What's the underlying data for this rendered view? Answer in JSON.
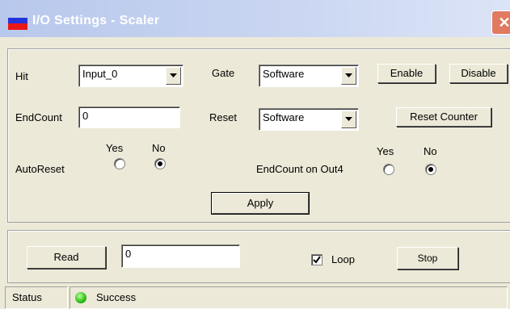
{
  "window": {
    "title": "I/O Settings - Scaler",
    "close_glyph": "✕"
  },
  "hit": {
    "label": "Hit",
    "value": "Input_0"
  },
  "gate": {
    "label": "Gate",
    "value": "Software",
    "enable_label": "Enable",
    "disable_label": "Disable"
  },
  "endcount": {
    "label": "EndCount",
    "value": "0"
  },
  "reset": {
    "label": "Reset",
    "value": "Software",
    "reset_counter_label": "Reset Counter"
  },
  "autoreset": {
    "label": "AutoReset",
    "yes_label": "Yes",
    "no_label": "No",
    "selected": "No"
  },
  "endcount_out4": {
    "label": "EndCount on Out4",
    "yes_label": "Yes",
    "no_label": "No",
    "selected": "No"
  },
  "apply_label": "Apply",
  "bottom": {
    "read_label": "Read",
    "read_value": "0",
    "loop_label": "Loop",
    "loop_checked": true,
    "stop_label": "Stop"
  },
  "statusbar": {
    "label": "Status",
    "value": "Success",
    "led_color": "#34c41a"
  }
}
